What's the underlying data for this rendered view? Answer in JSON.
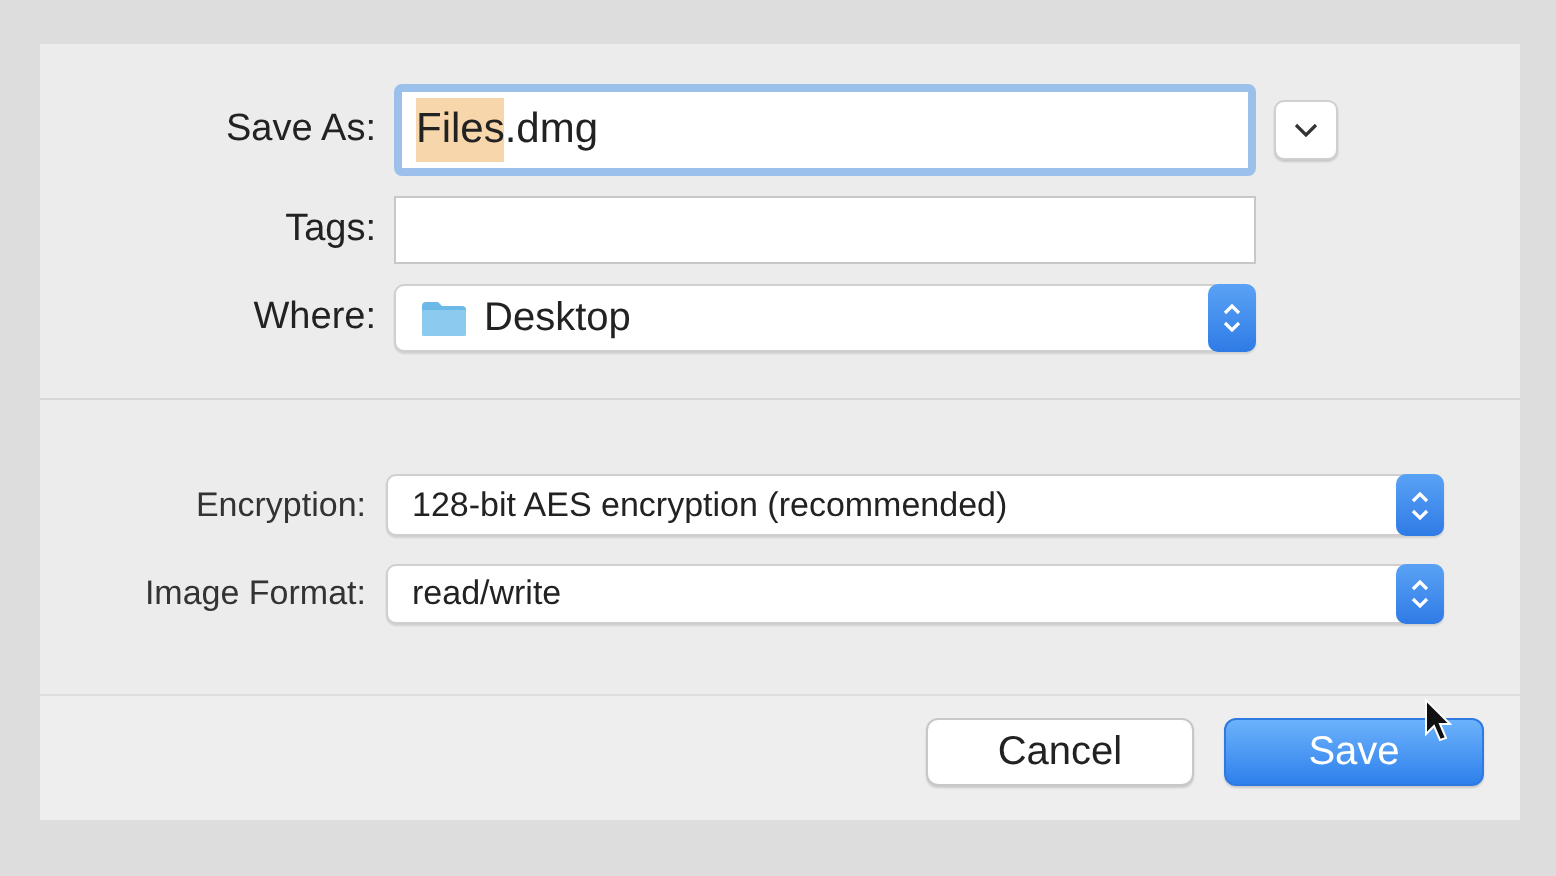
{
  "save_as": {
    "label": "Save As:",
    "value_parts": [
      {
        "text": "Files",
        "selected": true
      },
      {
        "text": ".dmg",
        "selected": false
      }
    ],
    "focused": true,
    "expanded": false
  },
  "tags": {
    "label": "Tags:"
  },
  "where": {
    "label": "Where:",
    "value": "Desktop"
  },
  "options": [
    {
      "label": "Encryption:",
      "value": "128-bit AES encryption (recommended)"
    },
    {
      "label": "Image Format:",
      "value": "read/write"
    }
  ],
  "buttons": [
    {
      "label": "Cancel",
      "kind": "secondary"
    },
    {
      "label": "Save",
      "kind": "default"
    }
  ]
}
